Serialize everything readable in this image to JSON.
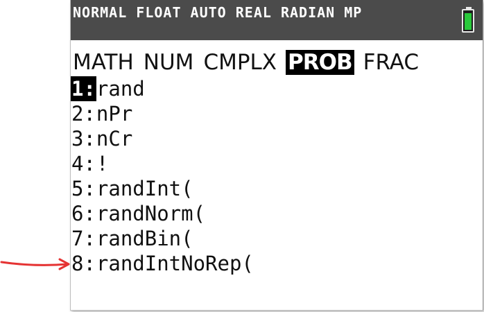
{
  "status_bar": {
    "text": "NORMAL FLOAT AUTO REAL RADIAN MP",
    "battery_color": "#29c93b"
  },
  "tabs": [
    {
      "label": "MATH",
      "selected": false
    },
    {
      "label": "NUM",
      "selected": false
    },
    {
      "label": "CMPLX",
      "selected": false
    },
    {
      "label": "PROB",
      "selected": true
    },
    {
      "label": "FRAC",
      "selected": false
    }
  ],
  "menu": {
    "items": [
      {
        "num": "1:",
        "label": "rand"
      },
      {
        "num": "2:",
        "label": "nPr"
      },
      {
        "num": "3:",
        "label": "nCr"
      },
      {
        "num": "4:",
        "label": "!"
      },
      {
        "num": "5:",
        "label": "randInt("
      },
      {
        "num": "6:",
        "label": "randNorm("
      },
      {
        "num": "7:",
        "label": "randBin("
      },
      {
        "num": "8:",
        "label": "randIntNoRep("
      }
    ],
    "cursor_index": 0
  },
  "annotation": {
    "arrow_color": "#e53333",
    "points_to_item": 8
  }
}
